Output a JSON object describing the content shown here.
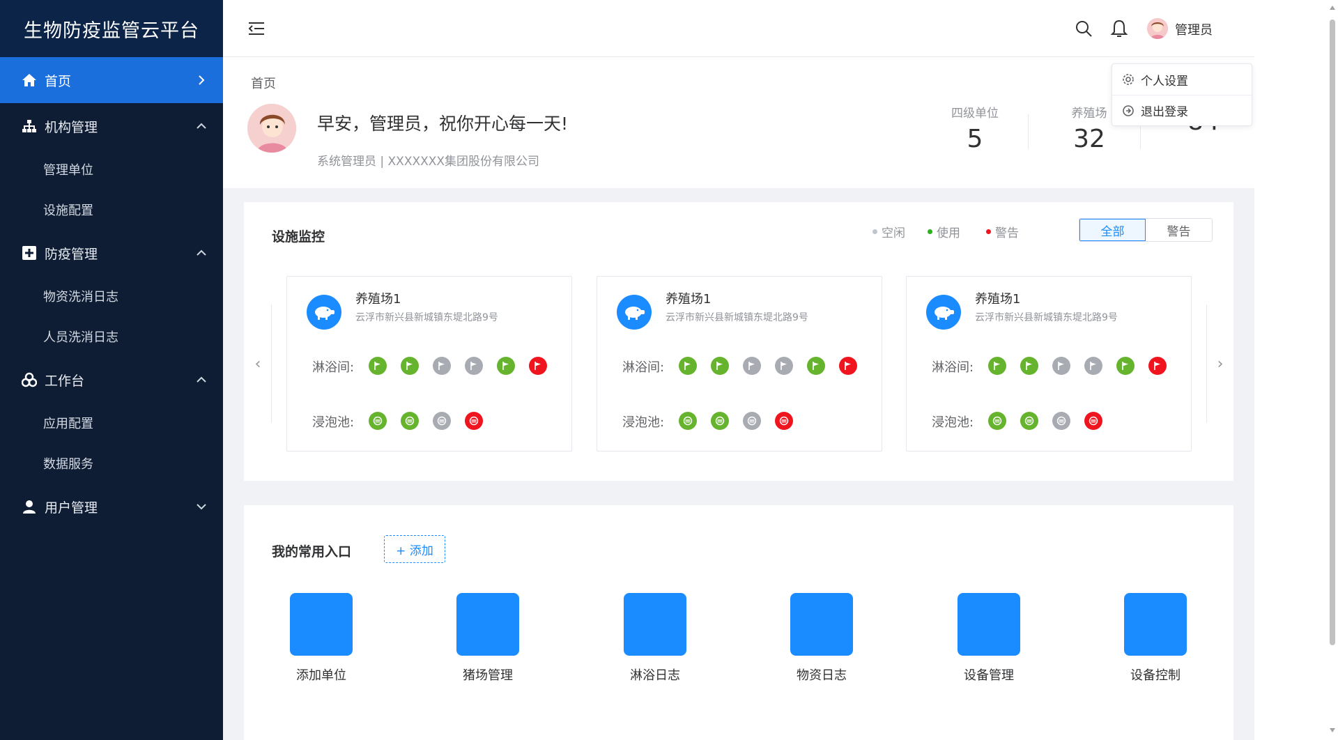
{
  "app": {
    "title": "生物防疫监管云平台"
  },
  "sidebar": {
    "items": [
      {
        "label": "首页",
        "icon": "home-icon",
        "active": true
      },
      {
        "label": "机构管理",
        "icon": "org-chart-icon",
        "children": [
          "管理单位",
          "设施配置"
        ]
      },
      {
        "label": "防疫管理",
        "icon": "medical-cross-icon",
        "children": [
          "物资洗消日志",
          "人员洗消日志"
        ]
      },
      {
        "label": "工作台",
        "icon": "biohazard-icon",
        "children": [
          "应用配置",
          "数据服务"
        ]
      },
      {
        "label": "用户管理",
        "icon": "user-icon"
      }
    ]
  },
  "topbar": {
    "username": "管理员"
  },
  "dropdown": {
    "settings": "个人设置",
    "logout": "退出登录"
  },
  "header": {
    "breadcrumb": "首页",
    "greeting": "早安，管理员，祝你开心每一天!",
    "subline": "系统管理员  |  XXXXXXX集团股份有限公司",
    "stats": [
      {
        "label": "四级单位",
        "value": "5"
      },
      {
        "label": "养殖场",
        "value": "32"
      },
      {
        "label": "",
        "value": "84"
      }
    ]
  },
  "monitor": {
    "title": "设施监控",
    "legend": {
      "idle": "空闲",
      "in_use": "使用",
      "warning": "警告"
    },
    "filters": {
      "all": "全部",
      "warning": "警告"
    },
    "colors": {
      "green": "#66b32e",
      "gray": "#a8abb2",
      "red": "#f0141e",
      "accent": "#1a8cff"
    },
    "cards": [
      {
        "name": "养殖场1",
        "address": "云浮市新兴县新城镇东堤北路9号",
        "shower_label": "淋浴间:",
        "shower_status": [
          "green",
          "green",
          "gray",
          "gray",
          "green",
          "red"
        ],
        "pool_label": "浸泡池:",
        "pool_status": [
          "green",
          "green",
          "gray",
          "red"
        ]
      },
      {
        "name": "养殖场1",
        "address": "云浮市新兴县新城镇东堤北路9号",
        "shower_label": "淋浴间:",
        "shower_status": [
          "green",
          "green",
          "gray",
          "gray",
          "green",
          "red"
        ],
        "pool_label": "浸泡池:",
        "pool_status": [
          "green",
          "green",
          "gray",
          "red"
        ]
      },
      {
        "name": "养殖场1",
        "address": "云浮市新兴县新城镇东堤北路9号",
        "shower_label": "淋浴间:",
        "shower_status": [
          "green",
          "green",
          "gray",
          "gray",
          "green",
          "red"
        ],
        "pool_label": "浸泡池:",
        "pool_status": [
          "green",
          "green",
          "gray",
          "red"
        ]
      }
    ]
  },
  "shortcuts": {
    "title": "我的常用入口",
    "add_label": "+ 添加",
    "items": [
      "添加单位",
      "猪场管理",
      "淋浴日志",
      "物资日志",
      "设备管理",
      "设备控制"
    ]
  }
}
